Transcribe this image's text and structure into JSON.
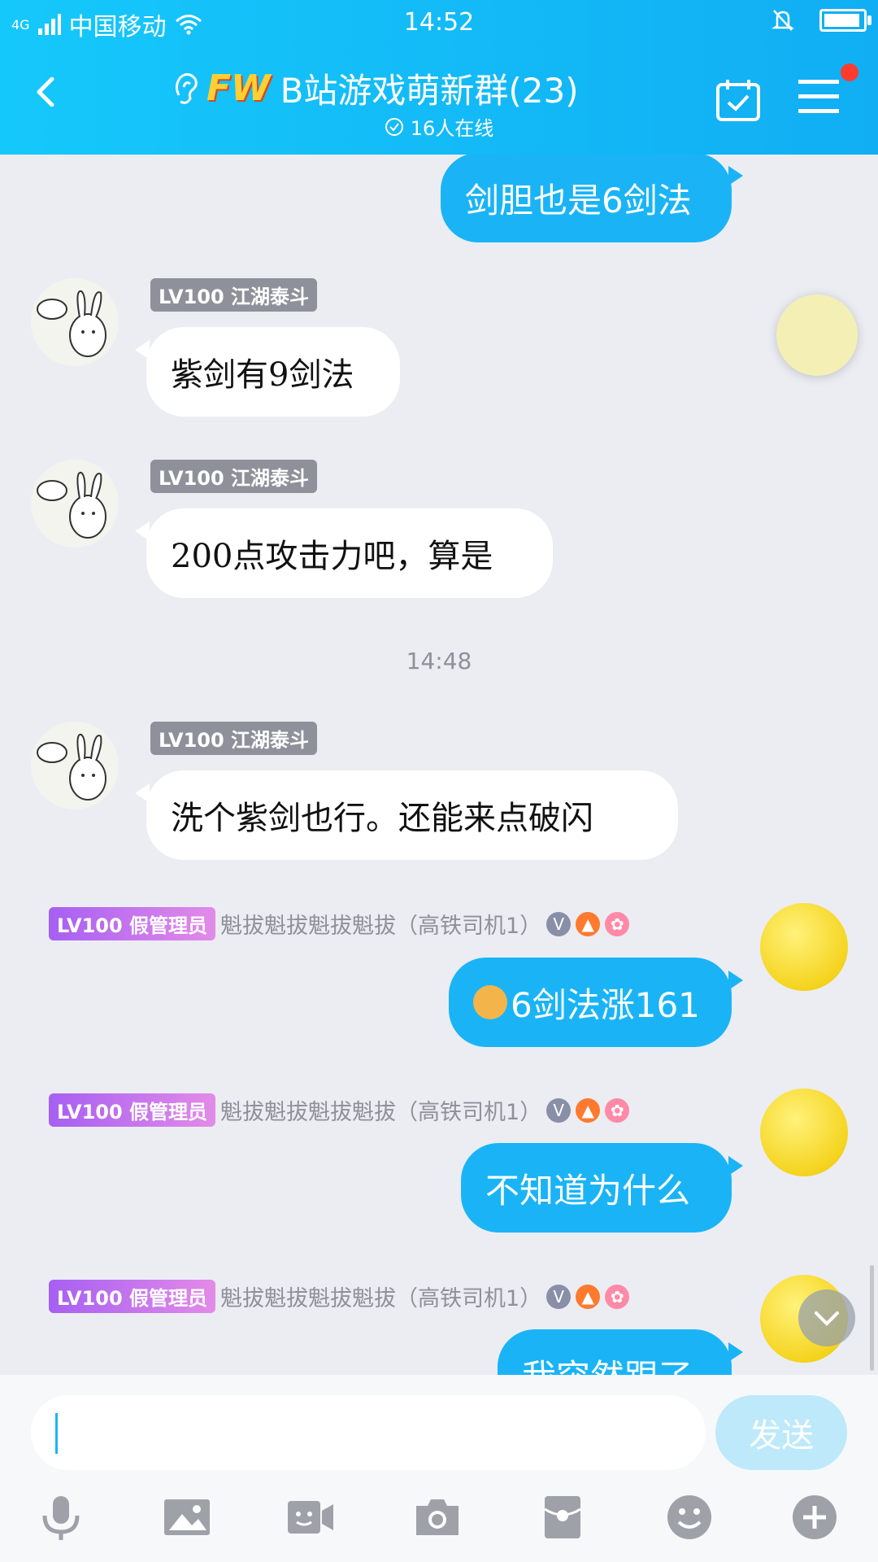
{
  "status": {
    "network": "4G",
    "carrier": "中国移动",
    "time": "14:52",
    "battery": 0.92
  },
  "header": {
    "fw_logo": "FW",
    "title": "B站游戏萌新群(23)",
    "online": "16人在线"
  },
  "messages": [
    {
      "type": "out",
      "text": "剑胆也是6剑法"
    },
    {
      "type": "in",
      "level": "LV100",
      "name": "江湖泰斗",
      "text": "紫剑有9剑法"
    },
    {
      "type": "in",
      "level": "LV100",
      "name": "江湖泰斗",
      "text": "200点攻击力吧，算是"
    },
    {
      "type": "time",
      "text": "14:48"
    },
    {
      "type": "in",
      "level": "LV100",
      "name": "江湖泰斗",
      "text": "洗个紫剑也行。还能来点破闪"
    },
    {
      "type": "out",
      "level": "LV100",
      "role": "假管理员",
      "name": "魁拔魁拔魁拔魁拔（高铁司机1）",
      "text": "6剑法涨161"
    },
    {
      "type": "out",
      "level": "LV100",
      "role": "假管理员",
      "name": "魁拔魁拔魁拔魁拔（高铁司机1）",
      "text": "不知道为什么"
    },
    {
      "type": "out",
      "level": "LV100",
      "role": "假管理员",
      "name": "魁拔魁拔魁拔魁拔（高铁司机1）",
      "text": "我突然跟了"
    }
  ],
  "input": {
    "value": "",
    "send_label": "发送"
  },
  "toolbar": [
    "mic-icon",
    "image-icon",
    "video-icon",
    "camera-icon",
    "red-packet-icon",
    "emoji-icon",
    "plus-icon"
  ],
  "colors": {
    "header": "#12b8f6",
    "bubble_out": "#1ab4f6",
    "admin_tag": "#b46cf0"
  }
}
